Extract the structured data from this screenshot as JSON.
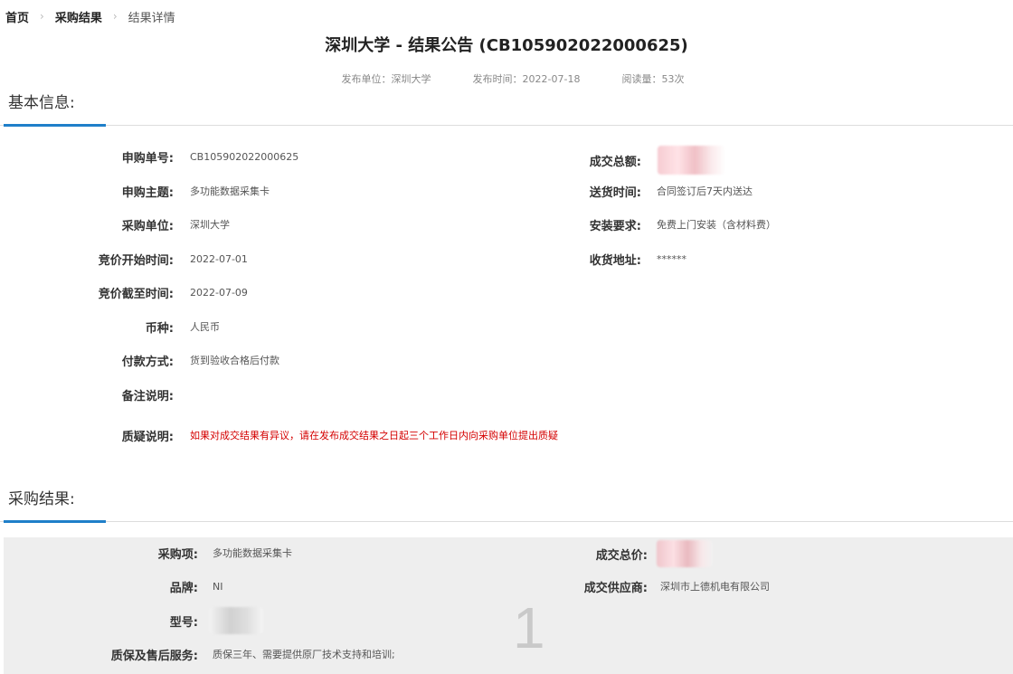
{
  "breadcrumb": {
    "home": "首页",
    "results": "采购结果",
    "current": "结果详情",
    "separator_icon": "chevron-right-icon"
  },
  "title": "深圳大学 - 结果公告 (CB105902022000625)",
  "meta": {
    "publisher": "发布单位：深圳大学",
    "publish_time": "发布时间：2022-07-18",
    "reads": "阅读量：53次"
  },
  "basic_info": {
    "title": "基本信息:",
    "accent": "#1f7fc9",
    "fields": {
      "request_no": {
        "label": "申购单号:",
        "value": "CB105902022000625"
      },
      "subject": {
        "label": "申购主题:",
        "value": "多功能数据采集卡"
      },
      "unit": {
        "label": "采购单位:",
        "value": "深圳大学"
      },
      "bid_start": {
        "label": "竞价开始时间:",
        "value": "2022-07-01"
      },
      "bid_end": {
        "label": "竞价截至时间:",
        "value": "2022-07-09"
      },
      "currency": {
        "label": "币种:",
        "value": "人民币"
      },
      "payment": {
        "label": "付款方式:",
        "value": "货到验收合格后付款"
      },
      "remarks": {
        "label": "备注说明:",
        "value": ""
      },
      "objection": {
        "label": "质疑说明:",
        "value": "如果对成交结果有异议，请在发布成交结果之日起三个工作日内向采购单位提出质疑"
      },
      "total_amount": {
        "label": "成交总额:"
      },
      "delivery_time": {
        "label": "送货时间:",
        "value": "合同签订后7天内送达"
      },
      "install": {
        "label": "安装要求:",
        "value": "免费上门安装（含材料费）"
      },
      "address": {
        "label": "收货地址:",
        "value": "******"
      }
    }
  },
  "result": {
    "title": "采购结果:",
    "index": "1",
    "fields": {
      "item": {
        "label": "采购项:",
        "value": "多功能数据采集卡"
      },
      "brand": {
        "label": "品牌:",
        "value": "NI"
      },
      "model": {
        "label": "型号:"
      },
      "warranty": {
        "label": "质保及售后服务:",
        "value": "质保三年、需要提供原厂技术支持和培训;"
      },
      "total_price": {
        "label": "成交总价:"
      },
      "supplier": {
        "label": "成交供应商:",
        "value": "深圳市上德机电有限公司"
      }
    }
  }
}
